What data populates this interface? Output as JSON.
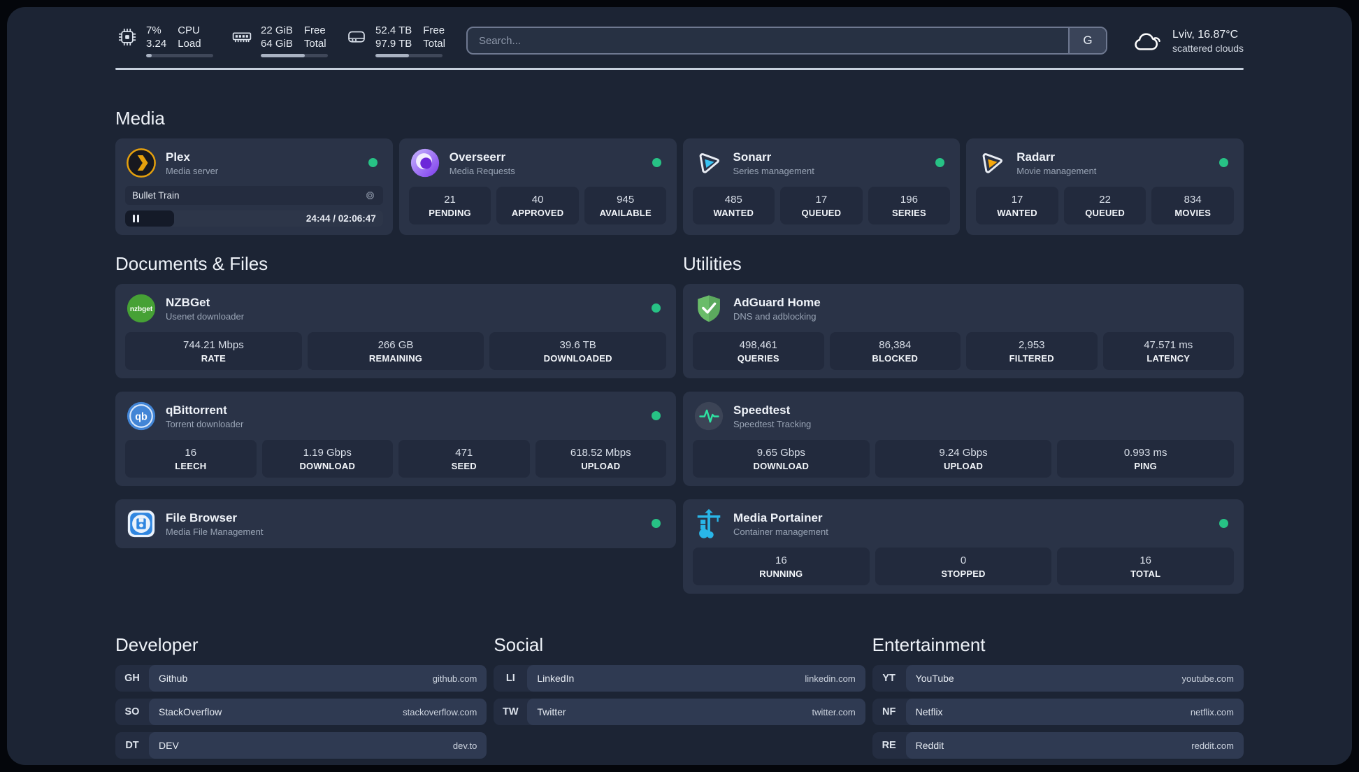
{
  "header": {
    "metrics": [
      {
        "icon": "cpu-icon",
        "value_top": "7%",
        "value_bottom": "3.24",
        "label_top": "CPU",
        "label_bottom": "Load",
        "progress_pct": 8
      },
      {
        "icon": "memory-icon",
        "value_top": "22 GiB",
        "value_bottom": "64 GiB",
        "label_top": "Free",
        "label_bottom": "Total",
        "progress_pct": 66
      },
      {
        "icon": "disk-icon",
        "value_top": "52.4 TB",
        "value_bottom": "97.9 TB",
        "label_top": "Free",
        "label_bottom": "Total",
        "progress_pct": 50
      }
    ],
    "search": {
      "placeholder": "Search...",
      "button_label": "G"
    },
    "weather": {
      "icon": "cloud-icon",
      "line1": "Lviv, 16.87°C",
      "line2": "scattered clouds"
    }
  },
  "media": {
    "title": "Media",
    "apps": [
      {
        "name": "Plex",
        "description": "Media server",
        "icon": "plex-icon",
        "online": true,
        "session": {
          "title": "Bullet Train",
          "time": "24:44 / 02:06:47",
          "progress_pct": 19
        }
      },
      {
        "name": "Overseerr",
        "description": "Media Requests",
        "icon": "overseerr-icon",
        "online": true,
        "stats": [
          {
            "value": "21",
            "label": "PENDING"
          },
          {
            "value": "40",
            "label": "APPROVED"
          },
          {
            "value": "945",
            "label": "AVAILABLE"
          }
        ]
      },
      {
        "name": "Sonarr",
        "description": "Series management",
        "icon": "sonarr-icon",
        "online": true,
        "stats": [
          {
            "value": "485",
            "label": "WANTED"
          },
          {
            "value": "17",
            "label": "QUEUED"
          },
          {
            "value": "196",
            "label": "SERIES"
          }
        ]
      },
      {
        "name": "Radarr",
        "description": "Movie management",
        "icon": "radarr-icon",
        "online": true,
        "stats": [
          {
            "value": "17",
            "label": "WANTED"
          },
          {
            "value": "22",
            "label": "QUEUED"
          },
          {
            "value": "834",
            "label": "MOVIES"
          }
        ]
      }
    ]
  },
  "columns": [
    {
      "title": "Documents & Files",
      "apps": [
        {
          "name": "NZBGet",
          "description": "Usenet downloader",
          "icon": "nzbget-icon",
          "online": true,
          "stats": [
            {
              "value": "744.21 Mbps",
              "label": "RATE"
            },
            {
              "value": "266 GB",
              "label": "REMAINING"
            },
            {
              "value": "39.6 TB",
              "label": "DOWNLOADED"
            }
          ]
        },
        {
          "name": "qBittorrent",
          "description": "Torrent downloader",
          "icon": "qbittorrent-icon",
          "online": true,
          "stats": [
            {
              "value": "16",
              "label": "LEECH"
            },
            {
              "value": "1.19 Gbps",
              "label": "DOWNLOAD"
            },
            {
              "value": "471",
              "label": "SEED"
            },
            {
              "value": "618.52 Mbps",
              "label": "UPLOAD"
            }
          ]
        },
        {
          "name": "File Browser",
          "description": "Media File Management",
          "icon": "filebrowser-icon",
          "online": true
        }
      ]
    },
    {
      "title": "Utilities",
      "apps": [
        {
          "name": "AdGuard Home",
          "description": "DNS and adblocking",
          "icon": "adguard-icon",
          "online": false,
          "stats": [
            {
              "value": "498,461",
              "label": "QUERIES"
            },
            {
              "value": "86,384",
              "label": "BLOCKED"
            },
            {
              "value": "2,953",
              "label": "FILTERED"
            },
            {
              "value": "47.571 ms",
              "label": "LATENCY"
            }
          ]
        },
        {
          "name": "Speedtest",
          "description": "Speedtest Tracking",
          "icon": "speedtest-icon",
          "online": false,
          "stats": [
            {
              "value": "9.65 Gbps",
              "label": "DOWNLOAD"
            },
            {
              "value": "9.24 Gbps",
              "label": "UPLOAD"
            },
            {
              "value": "0.993 ms",
              "label": "PING"
            }
          ]
        },
        {
          "name": "Media Portainer",
          "description": "Container management",
          "icon": "portainer-icon",
          "online": true,
          "stats": [
            {
              "value": "16",
              "label": "RUNNING"
            },
            {
              "value": "0",
              "label": "STOPPED"
            },
            {
              "value": "16",
              "label": "TOTAL"
            }
          ]
        }
      ]
    }
  ],
  "bookmarks": [
    {
      "title": "Developer",
      "items": [
        {
          "abbr": "GH",
          "name": "Github",
          "url": "github.com"
        },
        {
          "abbr": "SO",
          "name": "StackOverflow",
          "url": "stackoverflow.com"
        },
        {
          "abbr": "DT",
          "name": "DEV",
          "url": "dev.to"
        }
      ]
    },
    {
      "title": "Social",
      "items": [
        {
          "abbr": "LI",
          "name": "LinkedIn",
          "url": "linkedin.com"
        },
        {
          "abbr": "TW",
          "name": "Twitter",
          "url": "twitter.com"
        }
      ]
    },
    {
      "title": "Entertainment",
      "items": [
        {
          "abbr": "YT",
          "name": "YouTube",
          "url": "youtube.com"
        },
        {
          "abbr": "NF",
          "name": "Netflix",
          "url": "netflix.com"
        },
        {
          "abbr": "RE",
          "name": "Reddit",
          "url": "reddit.com"
        }
      ]
    }
  ],
  "colors": {
    "background": "#1c2434",
    "card": "#2a3347",
    "stat_box": "#222a3d",
    "status_online": "#27c285",
    "accent_plex": "#e5a00d",
    "accent_sonarr": "#38c3f3",
    "accent_radarr": "#f7a80c",
    "accent_portainer": "#29b6e8"
  }
}
